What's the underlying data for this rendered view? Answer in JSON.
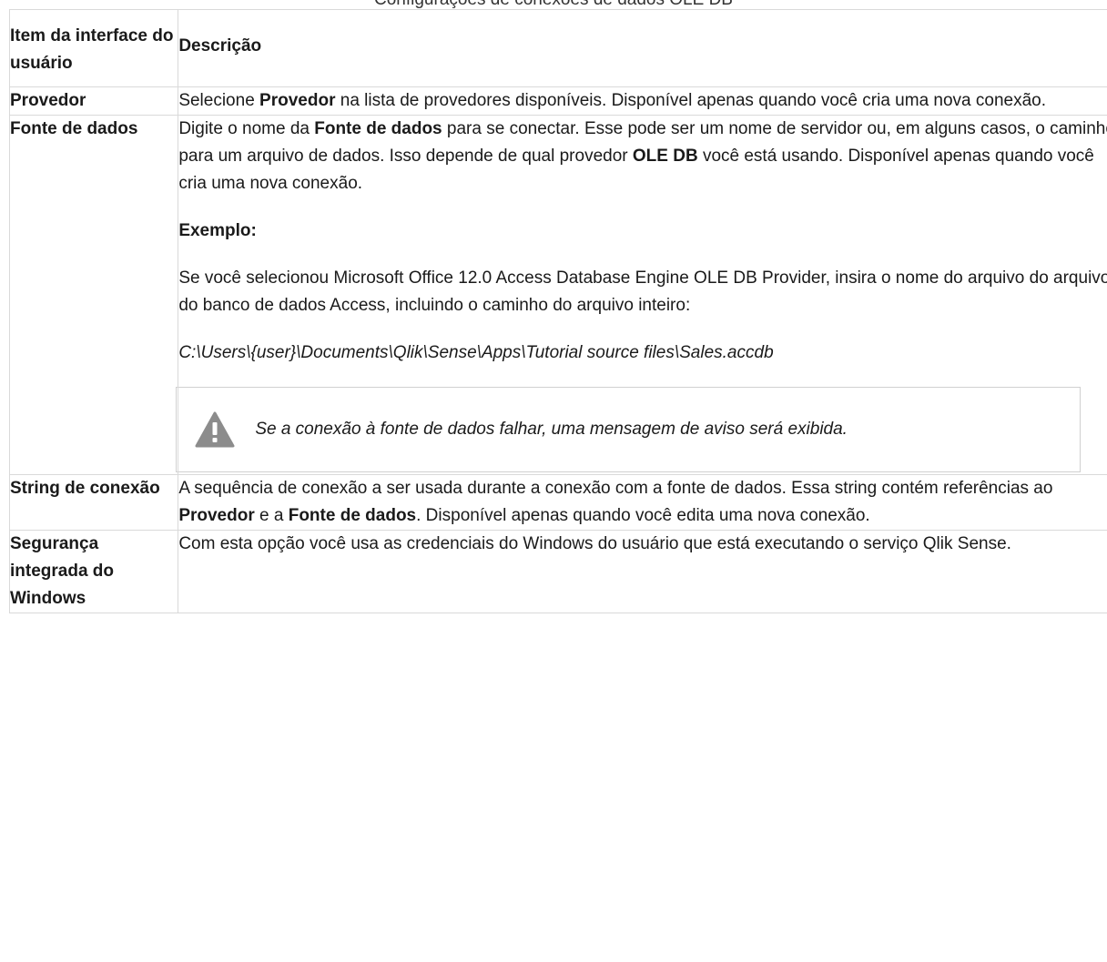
{
  "caption": "Configurações de conexões de dados OLE DB",
  "table": {
    "header": {
      "item": "Item da interface do usuário",
      "description": "Descrição"
    },
    "rows": [
      {
        "item": "Provedor",
        "desc": {
          "t1": "Selecione ",
          "b1": "Provedor",
          "t2": " na lista de provedores disponíveis. Disponível apenas quando você cria uma nova conexão."
        }
      },
      {
        "item": "Fonte de dados",
        "desc": {
          "t1": "Digite o nome da ",
          "b1": "Fonte de dados",
          "t2": " para se conectar. Esse pode ser um nome de servidor ou, em alguns casos, o caminho para um arquivo de dados. Isso depende de qual provedor ",
          "b2": "OLE DB",
          "t3": " você está usando. Disponível apenas quando você cria uma nova conexão.",
          "example_label": "Exemplo:",
          "example_text": "Se você selecionou Microsoft Office 12.0 Access Database Engine OLE DB Provider, insira o nome do arquivo do arquivo do banco de dados Access, incluindo o caminho do arquivo inteiro:",
          "example_path": "C:\\Users\\{user}\\Documents\\Qlik\\Sense\\Apps\\Tutorial source files\\Sales.accdb",
          "note_icon": "warning-icon",
          "note_text": "Se a conexão à fonte de dados falhar, uma mensagem de aviso será exibida."
        }
      },
      {
        "item": "String de conexão",
        "desc": {
          "t1": "A sequência de conexão a ser usada durante a conexão com a fonte de dados. Essa string contém referências ao ",
          "b1": "Provedor",
          "t2": " e a ",
          "b2": "Fonte de dados",
          "t3": ". Disponível apenas quando você edita uma nova conexão."
        }
      },
      {
        "item": "Segurança integrada do Windows",
        "desc": {
          "t1": "Com esta opção você usa as credenciais do Windows do usuário que está executando o serviço Qlik Sense."
        }
      }
    ]
  },
  "colors": {
    "border": "#d9d9d9",
    "icon": "#8c8c8c"
  }
}
